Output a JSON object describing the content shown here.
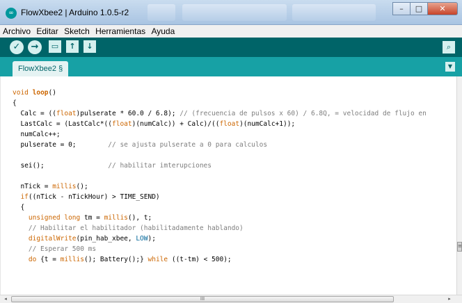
{
  "window": {
    "title": "FlowXbee2 | Arduino 1.0.5-r2",
    "app_icon": "arduino-icon",
    "minimize_label": "–",
    "maximize_label": "□",
    "close_label": "✕"
  },
  "menu": {
    "items": [
      {
        "label": "Archivo"
      },
      {
        "label": "Editar"
      },
      {
        "label": "Sketch"
      },
      {
        "label": "Herramientas"
      },
      {
        "label": "Ayuda"
      }
    ]
  },
  "toolbar": {
    "buttons": [
      {
        "icon": "verify-check-icon",
        "glyph": "✓"
      },
      {
        "icon": "upload-arrow-icon",
        "glyph": "→"
      },
      {
        "icon": "new-file-icon",
        "glyph": "▭"
      },
      {
        "icon": "open-icon",
        "glyph": "↑"
      },
      {
        "icon": "save-icon",
        "glyph": "↓"
      }
    ],
    "serial_monitor_icon": "magnifier-icon",
    "serial_glyph": "⌕",
    "accent_color": "#006468"
  },
  "tabs": {
    "active_tab": "FlowXbee2 §",
    "menu_glyph": "▼"
  },
  "editor": {
    "lines": [
      [
        {
          "t": "kw",
          "s": "void"
        },
        {
          "t": "",
          "s": " "
        },
        {
          "t": "kwb",
          "s": "loop"
        },
        {
          "t": "",
          "s": "()"
        }
      ],
      [
        {
          "t": "",
          "s": "{"
        }
      ],
      [
        {
          "t": "",
          "s": "  Calc = (("
        },
        {
          "t": "kw",
          "s": "float"
        },
        {
          "t": "",
          "s": ")pulserate * 60.0 / 6.8); "
        },
        {
          "t": "cm",
          "s": "// (frecuencia de pulsos x 60) / 6.8Q, = velocidad de flujo en"
        }
      ],
      [
        {
          "t": "",
          "s": "  LastCalc = (LastCalc*(("
        },
        {
          "t": "kw",
          "s": "float"
        },
        {
          "t": "",
          "s": ")(numCalc)) + Calc)/(("
        },
        {
          "t": "kw",
          "s": "float"
        },
        {
          "t": "",
          "s": ")(numCalc+1));"
        }
      ],
      [
        {
          "t": "",
          "s": "  numCalc++;"
        }
      ],
      [
        {
          "t": "",
          "s": "  pulserate = 0;        "
        },
        {
          "t": "cm",
          "s": "// se ajusta pulserate a 0 para calculos"
        }
      ],
      [
        {
          "t": "",
          "s": ""
        }
      ],
      [
        {
          "t": "",
          "s": "  sei();                "
        },
        {
          "t": "cm",
          "s": "// habilitar imterupciones"
        }
      ],
      [
        {
          "t": "",
          "s": ""
        }
      ],
      [
        {
          "t": "",
          "s": "  nTick = "
        },
        {
          "t": "kw",
          "s": "millis"
        },
        {
          "t": "",
          "s": "();"
        }
      ],
      [
        {
          "t": "",
          "s": "  "
        },
        {
          "t": "kw",
          "s": "if"
        },
        {
          "t": "",
          "s": "((nTick - nTickHour) > TIME_SEND)"
        }
      ],
      [
        {
          "t": "",
          "s": "  {"
        }
      ],
      [
        {
          "t": "",
          "s": "    "
        },
        {
          "t": "kw",
          "s": "unsigned long"
        },
        {
          "t": "",
          "s": " tm = "
        },
        {
          "t": "kw",
          "s": "millis"
        },
        {
          "t": "",
          "s": "(), t;"
        }
      ],
      [
        {
          "t": "",
          "s": "    "
        },
        {
          "t": "cm",
          "s": "// Habilitar el habilitador (habilitadamente hablando)"
        }
      ],
      [
        {
          "t": "",
          "s": "    "
        },
        {
          "t": "kw",
          "s": "digitalWrite"
        },
        {
          "t": "",
          "s": "(pin_hab_xbee, "
        },
        {
          "t": "const",
          "s": "LOW"
        },
        {
          "t": "",
          "s": ");"
        }
      ],
      [
        {
          "t": "",
          "s": "    "
        },
        {
          "t": "cm",
          "s": "// Esperar 500 ms"
        }
      ],
      [
        {
          "t": "",
          "s": "    "
        },
        {
          "t": "kw",
          "s": "do"
        },
        {
          "t": "",
          "s": " {t = "
        },
        {
          "t": "kw",
          "s": "millis"
        },
        {
          "t": "",
          "s": "(); Battery();} "
        },
        {
          "t": "kw",
          "s": "while"
        },
        {
          "t": "",
          "s": " ((t-tm) < 500);"
        }
      ]
    ]
  },
  "scrollbars": {
    "h_grip": "III",
    "v_grip": "≡",
    "left_arrow": "◂",
    "right_arrow": "▸"
  }
}
